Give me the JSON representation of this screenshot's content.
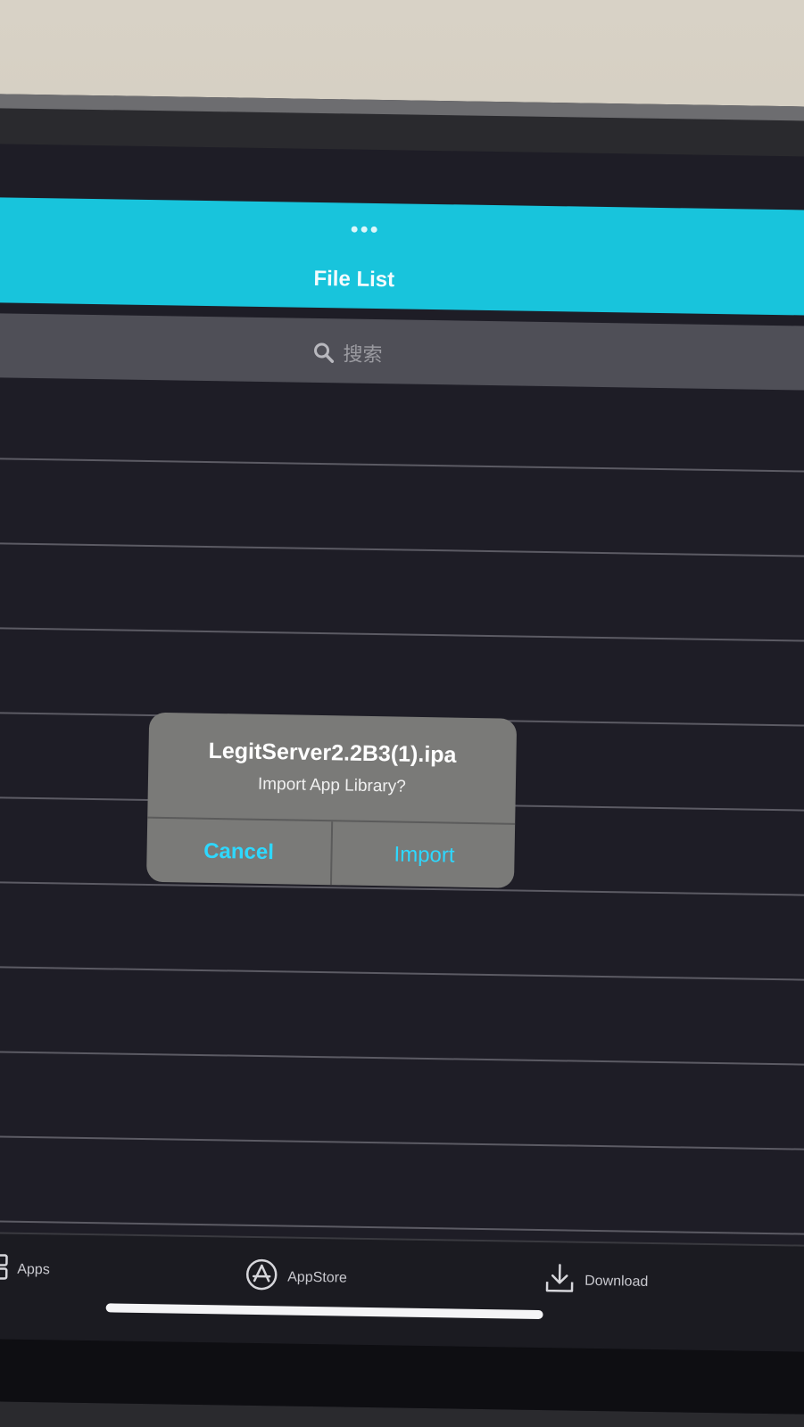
{
  "navbar": {
    "title": "File List"
  },
  "search": {
    "placeholder": "搜索"
  },
  "alert": {
    "title": "LegitServer2.2B3(1).ipa",
    "message": "Import App Library?",
    "cancel_label": "Cancel",
    "import_label": "Import"
  },
  "tabbar": {
    "items": [
      {
        "label": "Apps",
        "icon": "apps-grid-icon"
      },
      {
        "label": "AppStore",
        "icon": "appstore-icon"
      },
      {
        "label": "Download",
        "icon": "download-icon"
      }
    ]
  },
  "colors": {
    "accent": "#18c4dc",
    "alert_button": "#2ed8ff",
    "alert_bg": "#7a7a78",
    "screen_bg": "#1e1d26"
  }
}
